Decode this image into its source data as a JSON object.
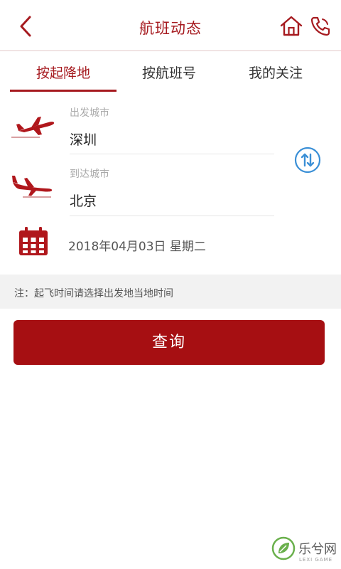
{
  "header": {
    "title": "航班动态",
    "back_icon": "chevron-left-icon",
    "home_icon": "home-icon",
    "phone_icon": "phone-icon"
  },
  "tabs": [
    {
      "label": "按起降地",
      "active": true
    },
    {
      "label": "按航班号",
      "active": false
    },
    {
      "label": "我的关注",
      "active": false
    }
  ],
  "departure": {
    "label": "出发城市",
    "value": "深圳",
    "icon": "plane-takeoff-icon"
  },
  "arrival": {
    "label": "到达城市",
    "value": "北京",
    "icon": "plane-landing-icon"
  },
  "swap": {
    "icon": "swap-icon"
  },
  "date": {
    "value": "2018年04月03日 星期二",
    "icon": "calendar-icon"
  },
  "notice": "注：起飞时间请选择出发地当地时间",
  "query_button": "查询",
  "watermark": {
    "text": "乐兮网",
    "sub": "LEXI GAME"
  },
  "colors": {
    "accent": "#a61a1f",
    "button": "#a60f12",
    "swap": "#3a8fd6"
  }
}
